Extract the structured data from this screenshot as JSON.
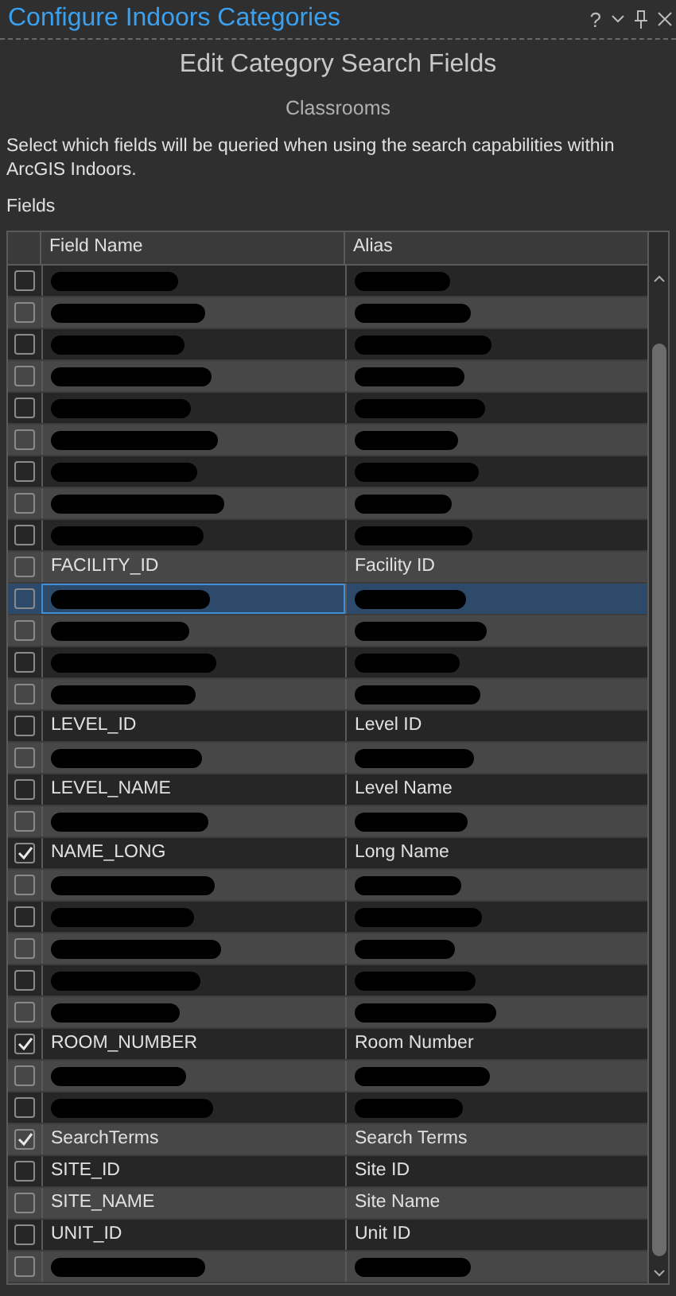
{
  "window": {
    "title": "Configure Indoors Categories",
    "controls": [
      "?"
    ]
  },
  "heading": "Edit Category Search Fields",
  "category": "Classrooms",
  "description": "Select which fields will be queried when using the search capabilities within ArcGIS Indoors.",
  "fields_label": "Fields",
  "table": {
    "columns": [
      "Field Name",
      "Alias"
    ],
    "rows": [
      {
        "kind": "redacted",
        "checked": false,
        "selected": false
      },
      {
        "kind": "redacted",
        "checked": false,
        "selected": false
      },
      {
        "kind": "redacted",
        "checked": false,
        "selected": false
      },
      {
        "kind": "redacted",
        "checked": false,
        "selected": false
      },
      {
        "kind": "redacted",
        "checked": false,
        "selected": false
      },
      {
        "kind": "redacted",
        "checked": false,
        "selected": false
      },
      {
        "kind": "redacted",
        "checked": false,
        "selected": false
      },
      {
        "kind": "redacted",
        "checked": false,
        "selected": false
      },
      {
        "kind": "redacted",
        "checked": false,
        "selected": false
      },
      {
        "kind": "field",
        "field_name": "FACILITY_ID",
        "alias": "Facility ID",
        "checked": false,
        "selected": false
      },
      {
        "kind": "redacted",
        "checked": false,
        "selected": true
      },
      {
        "kind": "redacted",
        "checked": false,
        "selected": false
      },
      {
        "kind": "redacted",
        "checked": false,
        "selected": false
      },
      {
        "kind": "redacted",
        "checked": false,
        "selected": false
      },
      {
        "kind": "field",
        "field_name": "LEVEL_ID",
        "alias": "Level ID",
        "checked": false,
        "selected": false
      },
      {
        "kind": "redacted",
        "checked": false,
        "selected": false
      },
      {
        "kind": "field",
        "field_name": "LEVEL_NAME",
        "alias": "Level Name",
        "checked": false,
        "selected": false
      },
      {
        "kind": "redacted",
        "checked": false,
        "selected": false
      },
      {
        "kind": "field",
        "field_name": "NAME_LONG",
        "alias": "Long Name",
        "checked": true,
        "selected": false
      },
      {
        "kind": "redacted",
        "checked": false,
        "selected": false
      },
      {
        "kind": "redacted",
        "checked": false,
        "selected": false
      },
      {
        "kind": "redacted",
        "checked": false,
        "selected": false
      },
      {
        "kind": "redacted",
        "checked": false,
        "selected": false
      },
      {
        "kind": "redacted",
        "checked": false,
        "selected": false
      },
      {
        "kind": "field",
        "field_name": "ROOM_NUMBER",
        "alias": "Room Number",
        "checked": true,
        "selected": false
      },
      {
        "kind": "redacted",
        "checked": false,
        "selected": false
      },
      {
        "kind": "redacted",
        "checked": false,
        "selected": false
      },
      {
        "kind": "field",
        "field_name": "SearchTerms",
        "alias": "Search Terms",
        "checked": true,
        "selected": false
      },
      {
        "kind": "field",
        "field_name": "SITE_ID",
        "alias": "Site ID",
        "checked": false,
        "selected": false
      },
      {
        "kind": "field",
        "field_name": "SITE_NAME",
        "alias": "Site Name",
        "checked": false,
        "selected": false
      },
      {
        "kind": "field",
        "field_name": "UNIT_ID",
        "alias": "Unit ID",
        "checked": false,
        "selected": false
      },
      {
        "kind": "redacted",
        "checked": false,
        "selected": false
      }
    ]
  }
}
